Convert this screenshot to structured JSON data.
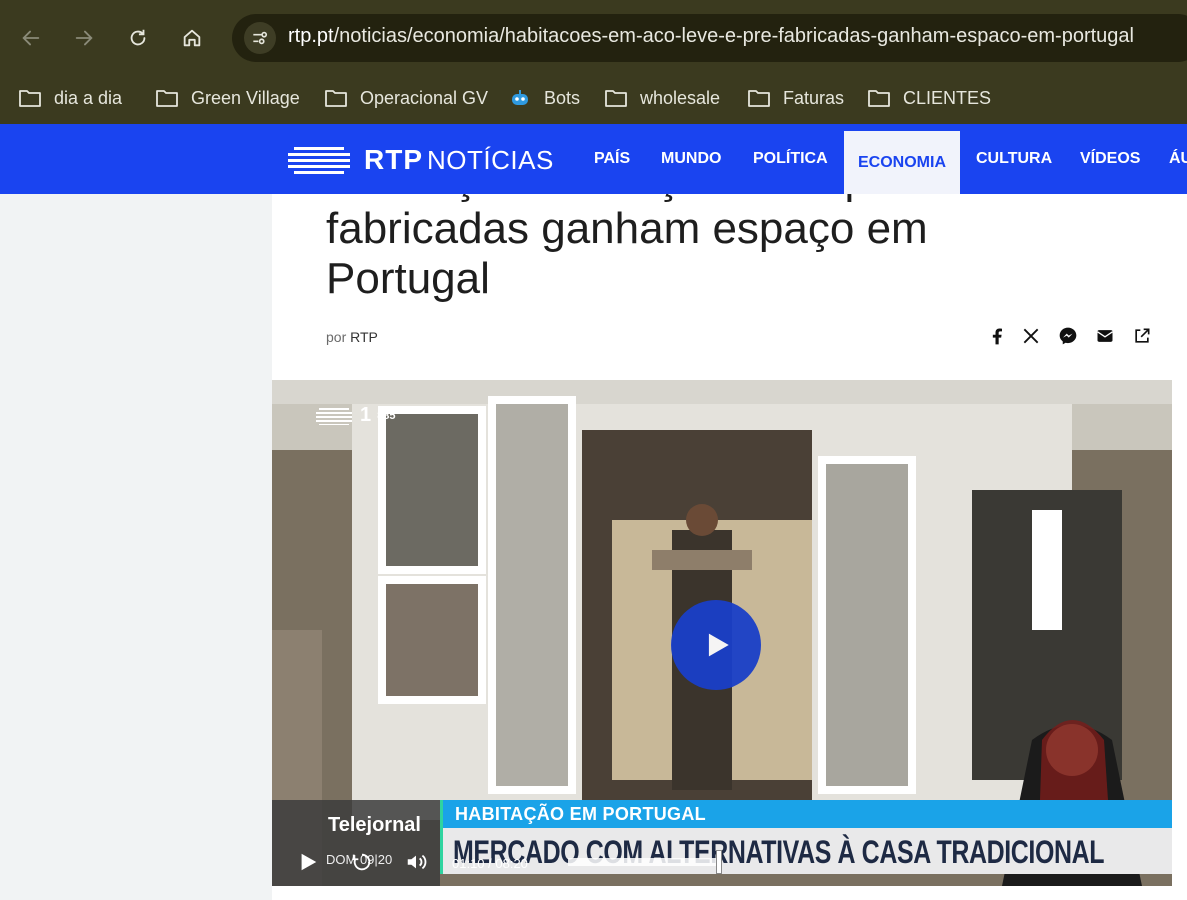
{
  "browser": {
    "url_host": "rtp.pt",
    "url_path": "/noticias/economia/habitacoes-em-aco-leve-e-pre-fabricadas-ganham-espaco-em-portugal",
    "bookmarks": [
      {
        "label": "dia a dia",
        "icon": "folder-icon"
      },
      {
        "label": "Green Village",
        "icon": "folder-icon"
      },
      {
        "label": "Operacional GV",
        "icon": "folder-icon"
      },
      {
        "label": "Bots",
        "icon": "robot-icon"
      },
      {
        "label": "wholesale",
        "icon": "folder-icon"
      },
      {
        "label": "Faturas",
        "icon": "folder-icon"
      },
      {
        "label": "CLIENTES",
        "icon": "folder-icon"
      }
    ]
  },
  "site": {
    "logo_rtp": "RTP",
    "logo_noticias": "NOTÍCIAS",
    "menu": [
      {
        "label": "PAÍS",
        "active": false
      },
      {
        "label": "MUNDO",
        "active": false
      },
      {
        "label": "POLÍTICA",
        "active": false
      },
      {
        "label": "ECONOMIA",
        "active": true
      },
      {
        "label": "CULTURA",
        "active": false
      },
      {
        "label": "VÍDEOS",
        "active": false
      },
      {
        "label": "ÁU",
        "active": false
      }
    ],
    "colors": {
      "brand": "#1a44f0",
      "active_bg": "#f1f3fb"
    }
  },
  "article": {
    "headline_partial": "Habitações em aço leve e pré-",
    "headline_line2": "fabricadas ganham espaço em",
    "headline_line3": "Portugal",
    "byline_prefix": "por",
    "byline_author": "RTP",
    "share_icons": [
      "facebook-icon",
      "x-icon",
      "messenger-icon",
      "email-icon",
      "share-icon"
    ]
  },
  "video": {
    "channel_number": "1",
    "channel_code": "885",
    "show": "Telejornal",
    "date": "DOM 09|20",
    "topic": "HABITAÇÃO EM PORTUGAL",
    "headline": "MERCADO COM ALTERNATIVAS À CASA TRADICIONAL",
    "time_display": "01:10 / 08:20",
    "progress_fraction": 0.3
  }
}
